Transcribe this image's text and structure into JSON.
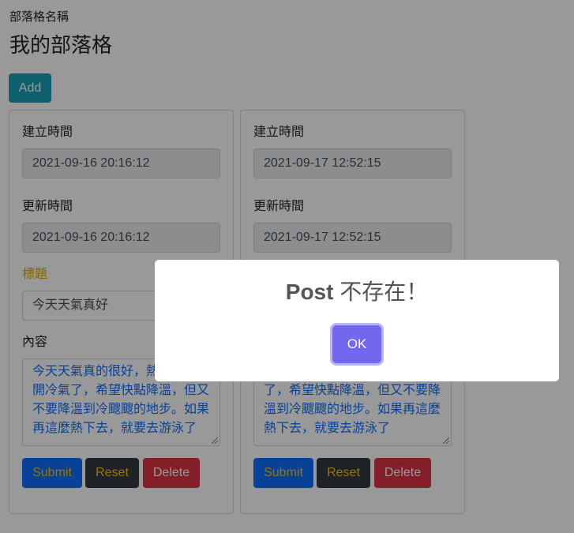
{
  "header": {
    "blog_label": "部落格名稱",
    "blog_title": "我的部落格",
    "add_label": "Add"
  },
  "labels": {
    "created": "建立時間",
    "updated": "更新時間",
    "title": "標題",
    "content": "內容"
  },
  "posts": [
    {
      "created": "2021-09-16 20:16:12",
      "updated": "2021-09-16 20:16:12",
      "title": "今天天氣真好",
      "content": "今天天氣真的很好，熱到有點想開冷氣了，希望快點降溫，但又不要降溫到冷颼颼的地步。如果再這麼熱下去，就要去游泳了"
    },
    {
      "created": "2021-09-17 12:52:15",
      "updated": "2021-09-17 12:52:15",
      "title": "",
      "content": "了，希望快點降溫，但又不要降溫到冷颼颼的地步。如果再這麼熱下去，就要去游泳了"
    }
  ],
  "buttons": {
    "submit": "Submit",
    "reset": "Reset",
    "delete": "Delete"
  },
  "modal": {
    "title_prefix": "Post",
    "title_suffix": " 不存在！",
    "ok": "OK"
  },
  "colors": {
    "add": "#17a2b8",
    "submit": "#0d6efd",
    "reset": "#343a40",
    "delete": "#dc3545",
    "ok": "#7367f0",
    "title_label": "#e0a800"
  }
}
